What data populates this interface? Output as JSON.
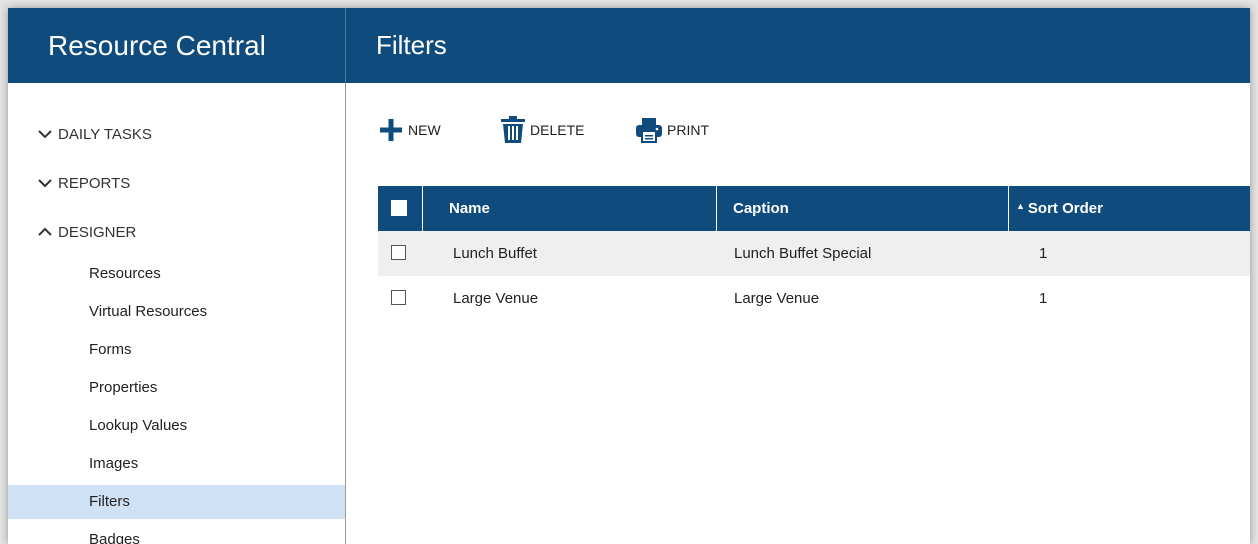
{
  "app": {
    "title": "Resource Central"
  },
  "page": {
    "title": "Filters"
  },
  "sidebar": {
    "sections": [
      {
        "label": "DAILY TASKS",
        "expanded": false,
        "icon": "chevron-down-icon"
      },
      {
        "label": "REPORTS",
        "expanded": false,
        "icon": "chevron-down-icon"
      },
      {
        "label": "DESIGNER",
        "expanded": true,
        "icon": "chevron-up-icon"
      }
    ],
    "items": [
      {
        "label": "Resources"
      },
      {
        "label": "Virtual Resources"
      },
      {
        "label": "Forms"
      },
      {
        "label": "Properties"
      },
      {
        "label": "Lookup Values"
      },
      {
        "label": "Images"
      },
      {
        "label": "Filters",
        "active": true
      },
      {
        "label": "Badges"
      }
    ]
  },
  "toolbar": {
    "new_label": "NEW",
    "delete_label": "DELETE",
    "print_label": "PRINT"
  },
  "table": {
    "columns": [
      "Name",
      "Caption",
      "Sort Order"
    ],
    "sort_column": "Sort Order",
    "sort_direction": "ascending",
    "rows": [
      {
        "name": "Lunch Buffet",
        "caption": "Lunch Buffet Special",
        "sort_order": "1"
      },
      {
        "name": "Large Venue",
        "caption": "Large Venue",
        "sort_order": "1"
      }
    ]
  },
  "colors": {
    "header": "#0f4c7d",
    "active_item": "#cfe2f5",
    "row_shade": "#efefef"
  }
}
